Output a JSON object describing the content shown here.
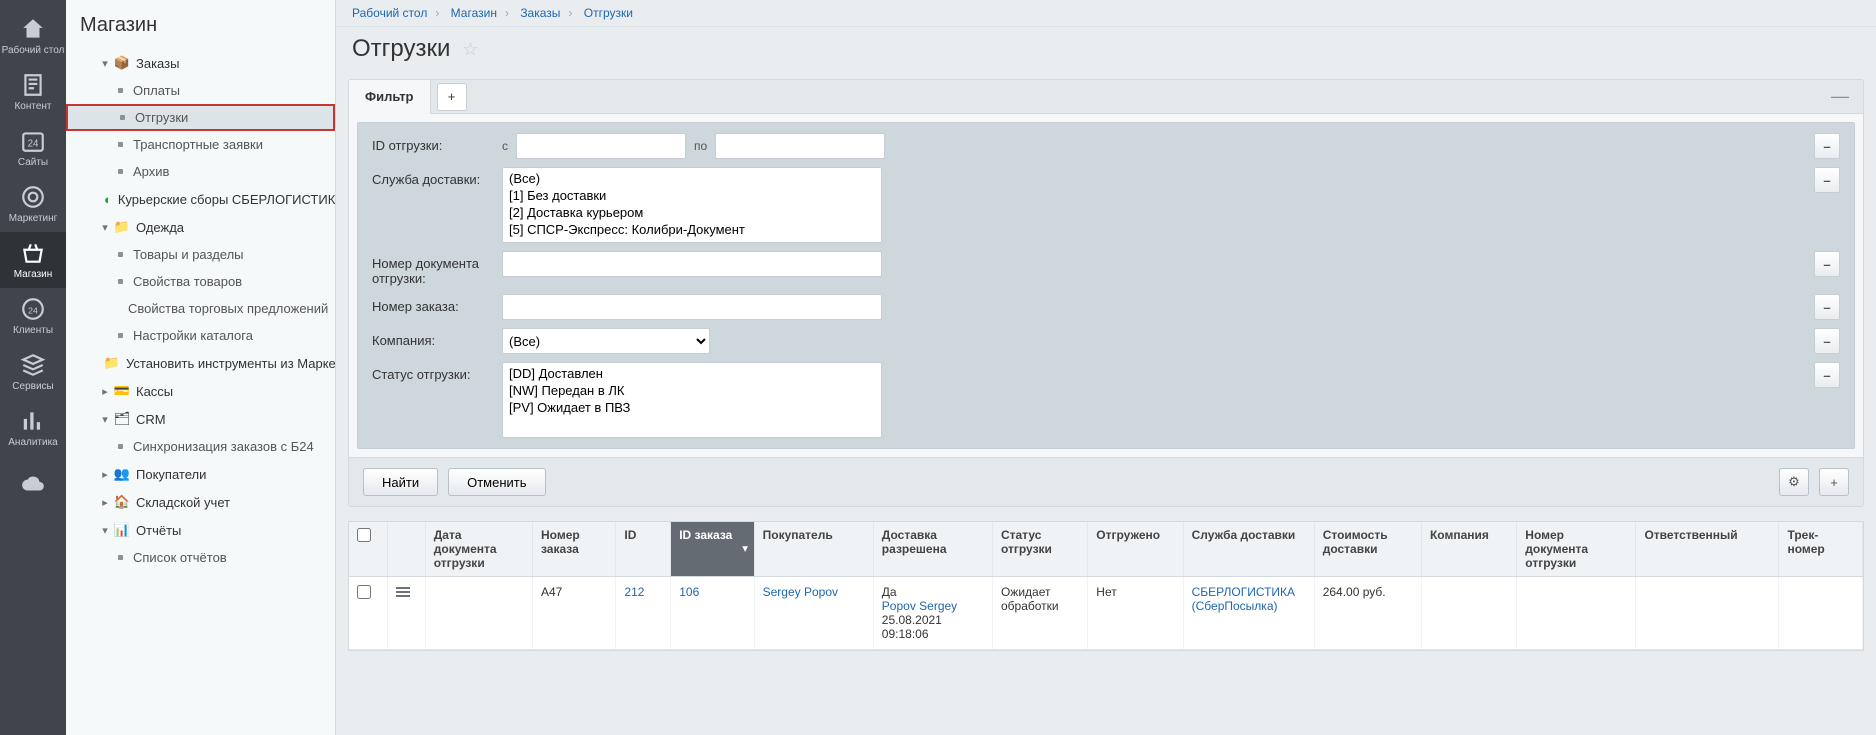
{
  "rail": {
    "items": [
      {
        "label": "Рабочий стол",
        "icon": "home"
      },
      {
        "label": "Контент",
        "icon": "doc"
      },
      {
        "label": "Сайты",
        "icon": "cal"
      },
      {
        "label": "Маркетинг",
        "icon": "target"
      },
      {
        "label": "Магазин",
        "icon": "basket",
        "active": true
      },
      {
        "label": "Клиенты",
        "icon": "clients"
      },
      {
        "label": "Сервисы",
        "icon": "stack"
      },
      {
        "label": "Аналитика",
        "icon": "chart"
      },
      {
        "label": "",
        "icon": "cloud"
      }
    ]
  },
  "sidebar": {
    "title": "Магазин",
    "orders_label": "Заказы",
    "sub_payments": "Оплаты",
    "sub_shipments": "Отгрузки",
    "sub_transport": "Транспортные заявки",
    "sub_archive": "Архив",
    "courier": "Курьерские сборы СБЕРЛОГИСТИКА",
    "clothes": "Одежда",
    "goods": "Товары и разделы",
    "props": "Свойства товаров",
    "trade_props": "Свойства торговых предложений",
    "cat_settings": "Настройки каталога",
    "marketplace": "Установить инструменты из Маркетплейс",
    "cash": "Кассы",
    "crm": "CRM",
    "crm_sync": "Синхронизация заказов с Б24",
    "buyers": "Покупатели",
    "warehouse": "Складской учет",
    "reports": "Отчёты",
    "report_list": "Список отчётов"
  },
  "crumbs": {
    "a": "Рабочий стол",
    "b": "Магазин",
    "c": "Заказы",
    "d": "Отгрузки"
  },
  "page": {
    "title": "Отгрузки"
  },
  "filter": {
    "tab": "Фильтр",
    "id_label": "ID отгрузки:",
    "from": "с",
    "to": "по",
    "delivery_label": "Служба доставки:",
    "delivery_options": [
      "(Все)",
      "[1] Без доставки",
      "[2] Доставка курьером",
      "[5] СПСР-Экспресс: Колибри-Документ"
    ],
    "docnum_label": "Номер документа отгрузки:",
    "ordernum_label": "Номер заказа:",
    "company_label": "Компания:",
    "company_value": "(Все)",
    "status_label": "Статус отгрузки:",
    "status_options": [
      "[DD] Доставлен",
      "[NW] Передан в ЛК",
      "[PV] Ожидает в ПВЗ"
    ],
    "find": "Найти",
    "cancel": "Отменить"
  },
  "grid": {
    "headers": {
      "date": "Дата документа отгрузки",
      "ordernum": "Номер заказа",
      "id": "ID",
      "orderid": "ID заказа",
      "buyer": "Покупатель",
      "allowed": "Доставка разрешена",
      "status": "Статус отгрузки",
      "shipped": "Отгружено",
      "service": "Служба доставки",
      "cost": "Стоимость доставки",
      "company": "Компания",
      "docnum": "Номер документа отгрузки",
      "responsible": "Ответственный",
      "track": "Трек-номер"
    },
    "row": {
      "ordernum": "A47",
      "id": "212",
      "orderid": "106",
      "buyer": "Sergey Popov",
      "allowed_yes": "Да",
      "allowed_name": "Popov Sergey",
      "allowed_date": "25.08.2021 09:18:06",
      "status": "Ожидает обработки",
      "shipped": "Нет",
      "service1": "СБЕРЛОГИСТИКА",
      "service2": "(СберПосылка)",
      "cost": "264.00 руб."
    }
  }
}
